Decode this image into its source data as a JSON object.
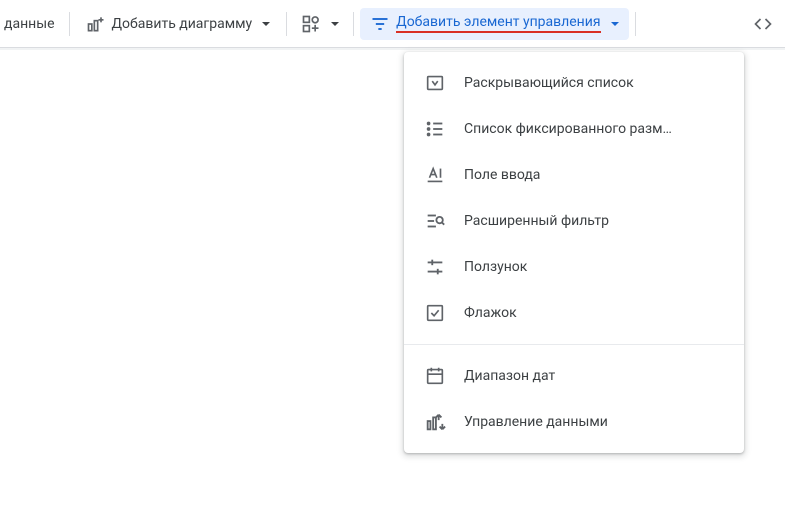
{
  "toolbar": {
    "truncated_left": "данные",
    "add_chart_label": "Добавить диаграмму",
    "add_control_label": "Добавить элемент управления"
  },
  "menu": {
    "items": [
      {
        "label": "Раскрывающийся список",
        "icon": "dropdown-list-icon"
      },
      {
        "label": "Список фиксированного разм…",
        "icon": "fixed-list-icon"
      },
      {
        "label": "Поле ввода",
        "icon": "input-field-icon"
      },
      {
        "label": "Расширенный фильтр",
        "icon": "advanced-filter-icon"
      },
      {
        "label": "Ползунок",
        "icon": "slider-icon"
      },
      {
        "label": "Флажок",
        "icon": "checkbox-icon"
      }
    ],
    "group2": [
      {
        "label": "Диапазон дат",
        "icon": "date-range-icon"
      },
      {
        "label": "Управление данными",
        "icon": "data-control-icon"
      }
    ]
  }
}
